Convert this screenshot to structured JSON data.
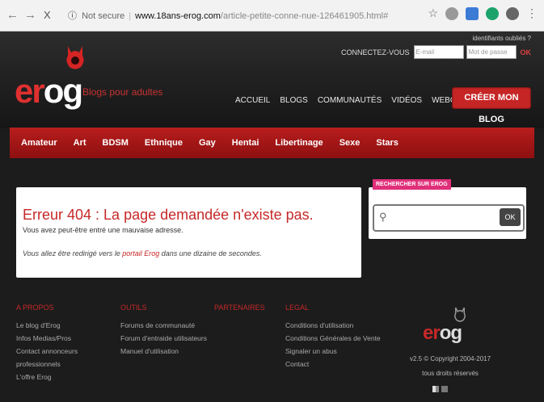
{
  "browser": {
    "back": "←",
    "forward": "→",
    "close": "X",
    "info": "ⓘ",
    "security": "Not secure",
    "url_host": "www.18ans-erog.com",
    "url_path": "/article-petite-conne-nue-126461905.html#",
    "star": "☆"
  },
  "header": {
    "logo_er": "er",
    "logo_og": "og",
    "tagline": "Blogs pour adultes",
    "forgot": "identifiants oubliés ?",
    "connect_label": "CONNECTEZ-VOUS",
    "email_placeholder": "E-mail",
    "password_placeholder": "Mot de passe",
    "ok": "OK",
    "nav": [
      "ACCUEIL",
      "BLOGS",
      "COMMUNAUTÉS",
      "VIDÉOS",
      "WEBCAMS"
    ],
    "create_blog": "CRÉER MON BLOG"
  },
  "categories": [
    "Amateur",
    "Art",
    "BDSM",
    "Ethnique",
    "Gay",
    "Hentai",
    "Libertinage",
    "Sexe",
    "Stars"
  ],
  "error": {
    "title": "Erreur 404 : La page demandée n'existe pas.",
    "subtitle": "Vous avez peut-être entré une mauvaise adresse.",
    "redirect_pre": "Vous allez être redirigé vers le ",
    "redirect_link": "portail Erog",
    "redirect_post": " dans une dizaine de secondes."
  },
  "search": {
    "tag": "RECHERCHER SUR EROG",
    "button": "OK"
  },
  "footer": {
    "about": {
      "title": "A PROPOS",
      "items": [
        "Le blog d'Erog",
        "Infos Medias/Pros",
        "Contact annonceurs",
        "professionnels",
        "L'offre Erog"
      ]
    },
    "tools": {
      "title": "OUTILS",
      "items": [
        "Forums de communauté",
        "Forum d'entraide utilisateurs",
        "Manuel d'utilisation"
      ]
    },
    "partners": {
      "title": "PARTENAIRES",
      "items": []
    },
    "legal": {
      "title": "LEGAL",
      "items": [
        "Conditions d'utilisation",
        "Conditions Générales de Vente",
        "Signaler un abus",
        "Contact"
      ]
    },
    "logo_e": "er",
    "logo_og": "og",
    "copyright": "v2.5 © Copyright 2004-2017",
    "rights": "tous droits réservés"
  },
  "colors": {
    "brand_red": "#c62828",
    "pink_tag": "#e0307a"
  }
}
